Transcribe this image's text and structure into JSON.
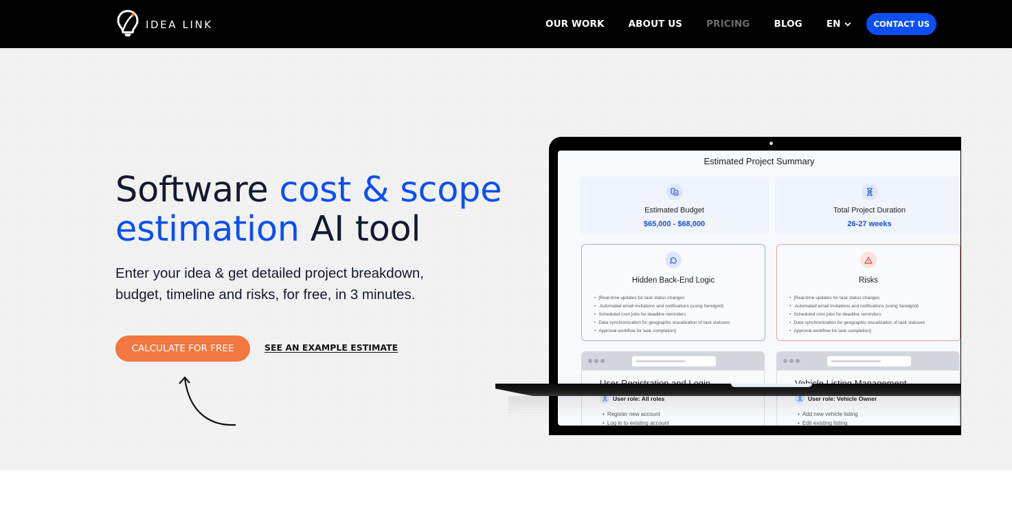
{
  "nav": {
    "logo_text": "IDEA LINK",
    "links": [
      {
        "label": "OUR WORK",
        "active": true
      },
      {
        "label": "ABOUT US",
        "active": true
      },
      {
        "label": "PRICING",
        "active": false
      },
      {
        "label": "BLOG",
        "active": true
      }
    ],
    "language": "EN",
    "contact_label": "CONTACT US"
  },
  "hero": {
    "headline_part1": "Software ",
    "headline_highlight1": "cost & scope",
    "headline_highlight2": "estimation",
    "headline_part2": " AI tool",
    "subtext": "Enter your idea & get detailed project breakdown, budget, timeline and risks, for free, in 3 minutes.",
    "cta_label": "CALCULATE FOR FREE",
    "example_link_label": "SEE AN EXAMPLE ESTIMATE"
  },
  "mockup": {
    "title": "Estimated Project Summary",
    "summary": [
      {
        "icon": "coins-icon",
        "label": "Estimated Budget",
        "value": "$65,000 - $68,000"
      },
      {
        "icon": "hourglass-icon",
        "label": "Total Project Duration",
        "value": "26-27 weeks"
      }
    ],
    "details": [
      {
        "icon": "puzzle-icon",
        "title": "Hidden Back-End Logic",
        "items": [
          "[Real-time updates for task status changes",
          " Automated email invitations and notifications (using Sendgrid)",
          "Scheduled cron jobs for deadline reminders",
          "Data synchronization for geographic visualization of task statuses",
          "Approval workflow for task completion]"
        ]
      },
      {
        "icon": "warning-icon",
        "title": "Risks",
        "items": [
          "[Real-time updates for task status changes",
          " Automated email invitations and notifications (using Sendgrid)",
          "Scheduled cron jobs for deadline reminders",
          "Data synchronization for geographic visualization of task statuses",
          "Approval workflow for task completion]"
        ]
      }
    ],
    "features": [
      {
        "title": "User Registration and Login",
        "role": "User role: All roles",
        "items": [
          "Register new account",
          "Log in to existing account"
        ]
      },
      {
        "title": "Vehicle Listing Management",
        "role": "User role: Vehicle Owner",
        "items": [
          "Add new vehicle listing",
          "Edit existing listing"
        ]
      }
    ]
  },
  "colors": {
    "brand_blue": "#0b4ff5",
    "cta_orange": "#f27740",
    "nav_bg": "#000000",
    "headline_dark": "#141a2e"
  }
}
